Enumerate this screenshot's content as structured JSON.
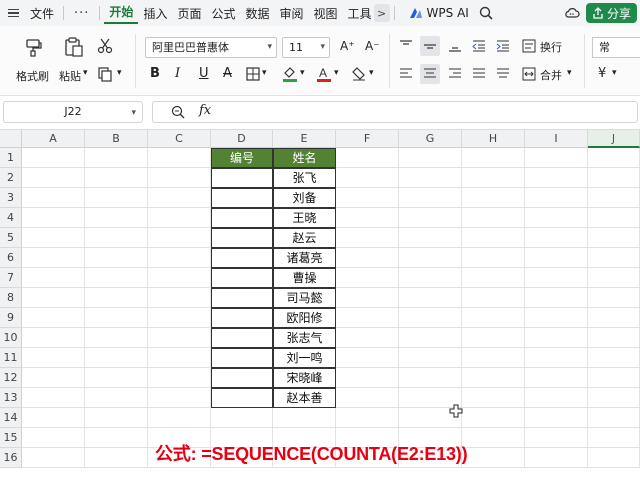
{
  "menubar": {
    "file_label": "文件",
    "more_label": "···",
    "tabs": [
      "开始",
      "插入",
      "页面",
      "公式",
      "数据",
      "审阅",
      "视图",
      "工具"
    ],
    "active_tab": "开始",
    "chevron": ">",
    "wps_ai_label": "WPS AI",
    "share_label": "分享"
  },
  "ribbon": {
    "format_painter_label": "格式刷",
    "paste_label": "粘贴",
    "font_name": "阿里巴巴普惠体",
    "font_size": "11",
    "wrap_label": "换行",
    "merge_label": "合并",
    "number_format_label": "常",
    "currency_symbol": "¥",
    "bold": "B",
    "italic": "I",
    "underline": "U",
    "strike": "A",
    "font_color_letter": "A",
    "grow_font": "A⁺",
    "shrink_font": "A⁻",
    "accent_color": "#1f8a4c",
    "highlight_color": "#2f9e44",
    "font_color": "#e02020"
  },
  "formula_bar": {
    "name_box": "J22",
    "fx_label": "fx",
    "value": ""
  },
  "sheet": {
    "columns": [
      "A",
      "B",
      "C",
      "D",
      "E",
      "F",
      "G",
      "H",
      "I",
      "J"
    ],
    "selected_column": "J",
    "rows": [
      "1",
      "2",
      "3",
      "4",
      "5",
      "6",
      "7",
      "8",
      "9",
      "10",
      "11",
      "12",
      "13",
      "14",
      "15",
      "16"
    ],
    "table_header": [
      "编号",
      "姓名"
    ],
    "names": [
      "张飞",
      "刘备",
      "王晓",
      "赵云",
      "诸葛亮",
      "曹操",
      "司马懿",
      "欧阳修",
      "张志气",
      "刘一鸣",
      "宋晓峰",
      "赵本善"
    ],
    "header_color": "#548235"
  },
  "annotation": {
    "formula_text": "公式: =SEQUENCE(COUNTA(E2:E13))",
    "color": "#e60012"
  }
}
